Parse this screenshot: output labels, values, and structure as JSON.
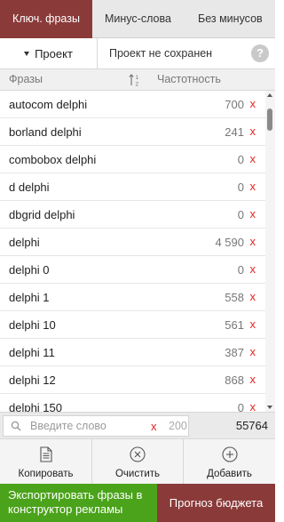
{
  "tabs": [
    {
      "label": "Ключ. фразы",
      "active": true
    },
    {
      "label": "Минус-слова",
      "active": false
    },
    {
      "label": "Без минусов",
      "active": false
    }
  ],
  "project": {
    "button_label": "Проект",
    "status": "Проект не сохранен",
    "help_label": "?"
  },
  "table": {
    "col_phrases": "Фразы",
    "col_frequency": "Частотность",
    "sort_icon": "sort-numeric-asc-icon",
    "rows": [
      {
        "phrase": "autocom delphi",
        "freq": "700",
        "remove": "x"
      },
      {
        "phrase": "borland delphi",
        "freq": "241",
        "remove": "x"
      },
      {
        "phrase": "combobox delphi",
        "freq": "0",
        "remove": "x"
      },
      {
        "phrase": "d delphi",
        "freq": "0",
        "remove": "x"
      },
      {
        "phrase": "dbgrid delphi",
        "freq": "0",
        "remove": "x"
      },
      {
        "phrase": "delphi",
        "freq": "4 590",
        "remove": "x"
      },
      {
        "phrase": "delphi 0",
        "freq": "0",
        "remove": "x"
      },
      {
        "phrase": "delphi 1",
        "freq": "558",
        "remove": "x"
      },
      {
        "phrase": "delphi 10",
        "freq": "561",
        "remove": "x"
      },
      {
        "phrase": "delphi 11",
        "freq": "387",
        "remove": "x"
      },
      {
        "phrase": "delphi 12",
        "freq": "868",
        "remove": "x"
      },
      {
        "phrase": "delphi 150",
        "freq": "0",
        "remove": "x"
      }
    ]
  },
  "search": {
    "placeholder": "Введите слово",
    "clear": "x",
    "max_length": "200",
    "total": "55764"
  },
  "actions": [
    {
      "label": "Копировать",
      "icon": "document-icon"
    },
    {
      "label": "Очистить",
      "icon": "clear-circle-icon"
    },
    {
      "label": "Добавить",
      "icon": "add-circle-icon"
    }
  ],
  "footer": {
    "export_line1": "Экспортировать фразы в",
    "export_line2": "конструктор рекламы",
    "forecast": "Прогноз бюджета"
  },
  "colors": {
    "accent": "#8b3a3a",
    "export_green": "#4aa31a",
    "remove_red": "#e52222"
  }
}
